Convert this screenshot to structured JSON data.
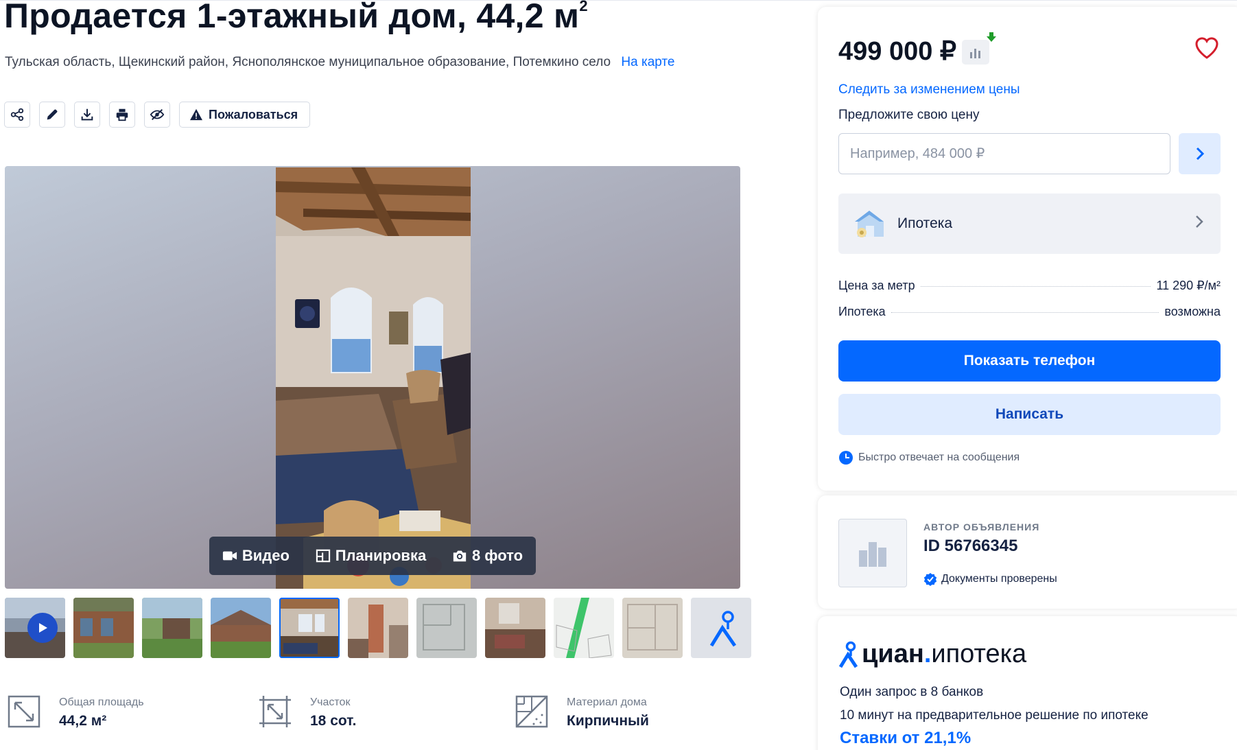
{
  "listing": {
    "title": "Продается 1-этажный дом, 44,2 м",
    "title_sup": "2",
    "address": "Тульская область, Щекинский район, Яснополянское муниципальное образование, Потемкино село",
    "map_link": "На карте"
  },
  "actions": {
    "icons": [
      "share-icon",
      "edit-icon",
      "download-icon",
      "print-icon",
      "hide-icon"
    ],
    "complain_label": "Пожаловаться"
  },
  "gallery": {
    "video_label": "Видео",
    "plan_label": "Планировка",
    "photos_label": "8 фото"
  },
  "features": [
    {
      "label": "Общая площадь",
      "value": "44,2 м²",
      "icon": "area-icon"
    },
    {
      "label": "Участок",
      "value": "18 сот.",
      "icon": "plot-icon"
    },
    {
      "label": "Материал дома",
      "value": "Кирпичный",
      "icon": "material-icon"
    }
  ],
  "price_card": {
    "price": "499 000 ₽",
    "track_price": "Следить за изменением цены",
    "offer_label": "Предложите свою цену",
    "offer_placeholder": "Например, 484 000 ₽",
    "mortgage_label": "Ипотека",
    "rows": [
      {
        "label": "Цена за метр",
        "value": "11 290 ₽/м²"
      },
      {
        "label": "Ипотека",
        "value": "возможна"
      }
    ],
    "show_phone": "Показать телефон",
    "write": "Написать",
    "reply_note": "Быстро отвечает на сообщения"
  },
  "author": {
    "label": "АВТОР ОБЪЯВЛЕНИЯ",
    "id": "ID 56766345",
    "docs": "Документы проверены"
  },
  "cian_mortgage": {
    "brand": "циан",
    "dot": ".",
    "product": "ипотека",
    "line1": "Один запрос в 8 банков",
    "line2": "10 минут на предварительное решение по ипотеке",
    "rate": "Ставки от 21,1%"
  },
  "colors": {
    "accent": "#0468ff",
    "accent_light": "#e0ecff",
    "text": "#152242",
    "price_down": "#1f9c2a"
  }
}
